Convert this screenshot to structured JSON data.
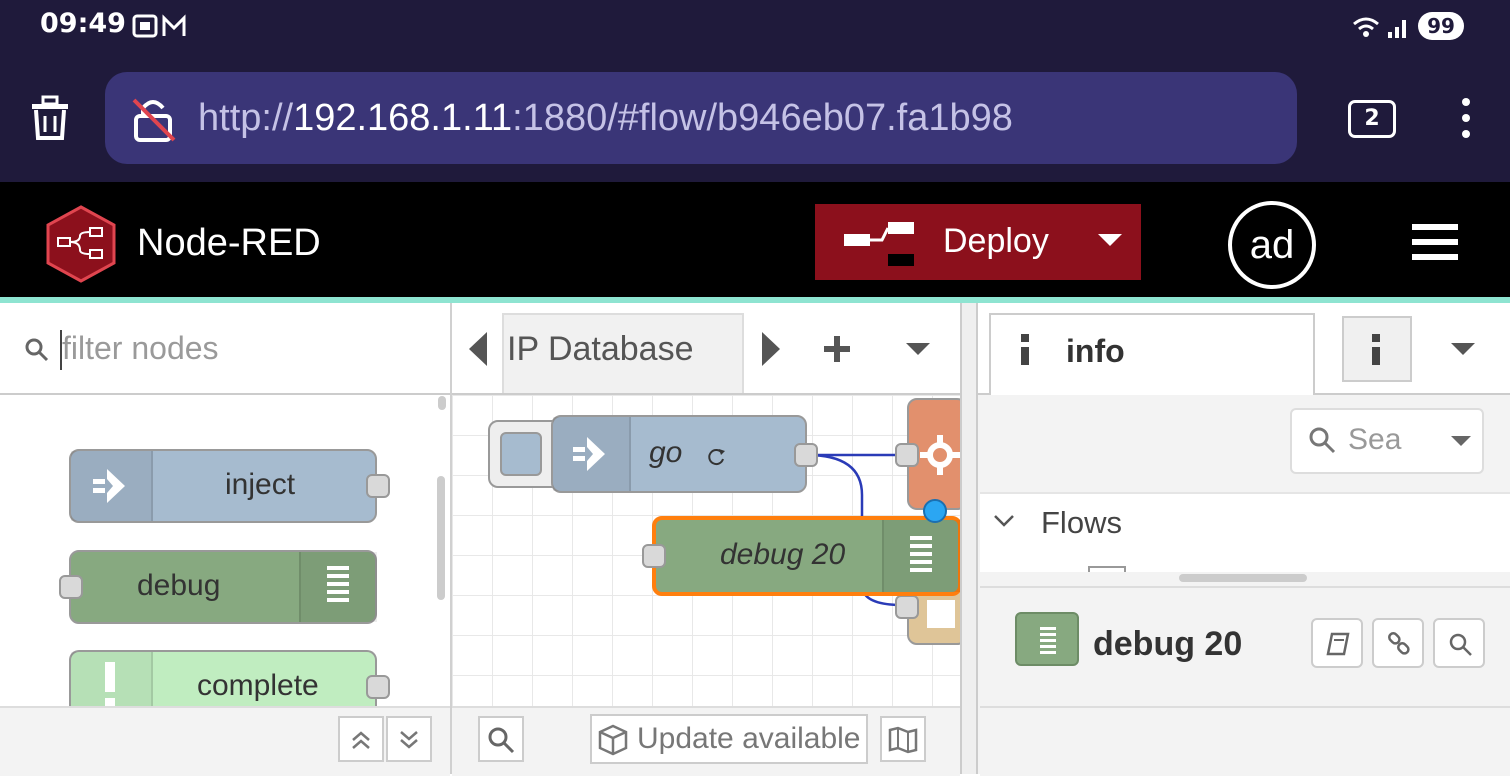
{
  "status_bar": {
    "time": "09:49",
    "battery": "99"
  },
  "browser": {
    "url_scheme": "http://",
    "url_host": "192.168.1.11",
    "url_rest": ":1880/#flow/b946eb07.fa1b98",
    "tab_count": "2"
  },
  "header": {
    "app_name": "Node-RED",
    "deploy_label": "Deploy",
    "avatar_initials": "ad",
    "accent_color": "#8c101c"
  },
  "palette": {
    "filter_placeholder": "filter nodes",
    "nodes": [
      {
        "label": "inject",
        "color": "#a6bbcf"
      },
      {
        "label": "debug",
        "color": "#87a980"
      },
      {
        "label": "complete",
        "color": "#c0edc0"
      }
    ]
  },
  "workspace": {
    "tab_label": "IP Database",
    "canvas_nodes": {
      "go_label": "go",
      "debug_label": "debug 20"
    },
    "update_label": "Update available"
  },
  "sidebar": {
    "tab_label": "info",
    "search_placeholder": "Sea",
    "flows_label": "Flows",
    "selected_node": "debug 20"
  }
}
